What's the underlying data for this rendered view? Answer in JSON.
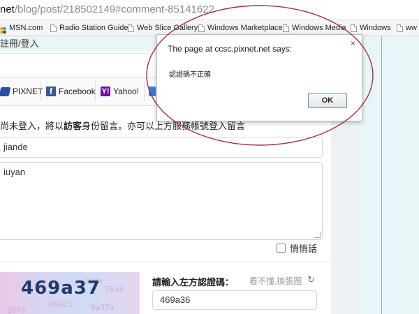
{
  "browser": {
    "url_host": "net",
    "url_path": "/blog/post/218502149#comment-85141622",
    "bookmarks": [
      {
        "label": "MSN.com",
        "icon": "msn-icon"
      },
      {
        "label": "Radio Station Guide",
        "icon": "page-icon"
      },
      {
        "label": "Web Slice Gallery",
        "icon": "page-icon"
      },
      {
        "label": "Windows Marketplace",
        "icon": "page-icon"
      },
      {
        "label": "Windows Media",
        "icon": "page-icon"
      },
      {
        "label": "Windows",
        "icon": "page-icon"
      },
      {
        "label": "ww",
        "icon": "page-icon"
      }
    ]
  },
  "page": {
    "top_text": "註冊/登入",
    "share": {
      "pixnet": "PIXNET",
      "facebook": "Facebook",
      "yahoo": "Yahoo!"
    },
    "notice_before": "尚未登入，將以",
    "notice_bold": "訪客",
    "notice_after": "身份留言。亦可以上方服務帳號登入留言",
    "name_value": "jiande",
    "message_value": "iuyan",
    "secret_label": "悄悄話",
    "captcha_code": "469a37",
    "captcha_noise": [
      "5b8a",
      "76a3",
      "46923",
      "9a37a",
      "1676"
    ],
    "captcha_label": "請輸入左方認證碼：",
    "captcha_help": "看不懂,換張圖",
    "captcha_value": "469a36"
  },
  "dialog": {
    "title": "The page at ccsc.pixnet.net says:",
    "message": "認證碼不正確",
    "ok_label": "OK",
    "close_glyph": "×"
  },
  "colors": {
    "annotation_ellipse": "#a0304a",
    "ok_border": "#6b8fc8"
  }
}
